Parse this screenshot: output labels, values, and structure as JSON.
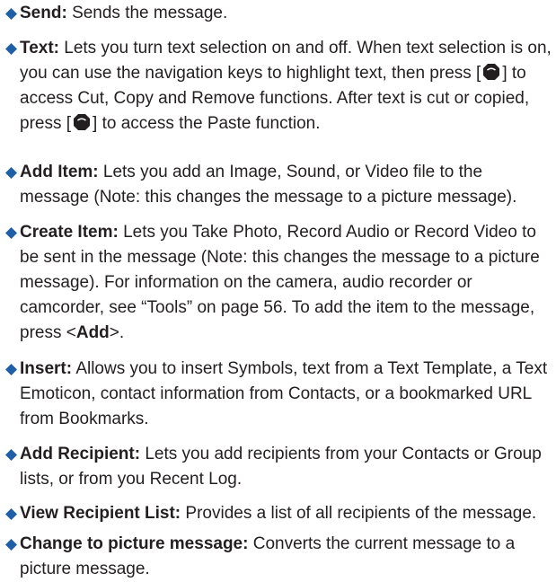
{
  "colors": {
    "bullet": "#1f5fa8",
    "text": "#231f20",
    "key_icon": "#231f20"
  },
  "icons": {
    "bullet": "diamond-bullet-icon",
    "key": "select-key-icon"
  },
  "items": [
    {
      "term": "Send:",
      "desc": "Sends the message."
    },
    {
      "term": "Text:",
      "desc_a": "Lets you turn text selection on and off. When text selection is on, you can use the navigation keys to highlight text, then press [",
      "desc_b": "] to access Cut, Copy and Remove functions. After text is cut or copied, press [",
      "desc_c": "] to access the Paste function."
    },
    {
      "term": "Add Item:",
      "desc": "Lets you add an Image, Sound, or Video file to the message (Note: this changes the message to a picture message)."
    },
    {
      "term": "Create Item:",
      "desc_a": "Lets you Take Photo, Record Audio or Record Video to be sent in the message (Note: this changes the message to a picture message). For information on the camera, audio recorder or camcorder, see “Tools” on page 56. To add the item to the message, press <",
      "key": "Add",
      "desc_b": ">."
    },
    {
      "term": "Insert:",
      "desc": "Allows you to insert Symbols, text from a Text Template, a Text Emoticon, contact information from Contacts, or a bookmarked URL from Bookmarks."
    },
    {
      "term": "Add Recipient:",
      "desc": "Lets you add recipients from your Contacts or Group lists, or from you Recent Log."
    },
    {
      "term": "View Recipient List:",
      "desc": "Provides a list of all recipients of the message."
    },
    {
      "term": "Change to picture message:",
      "desc": "Converts the current message to a picture message."
    }
  ]
}
